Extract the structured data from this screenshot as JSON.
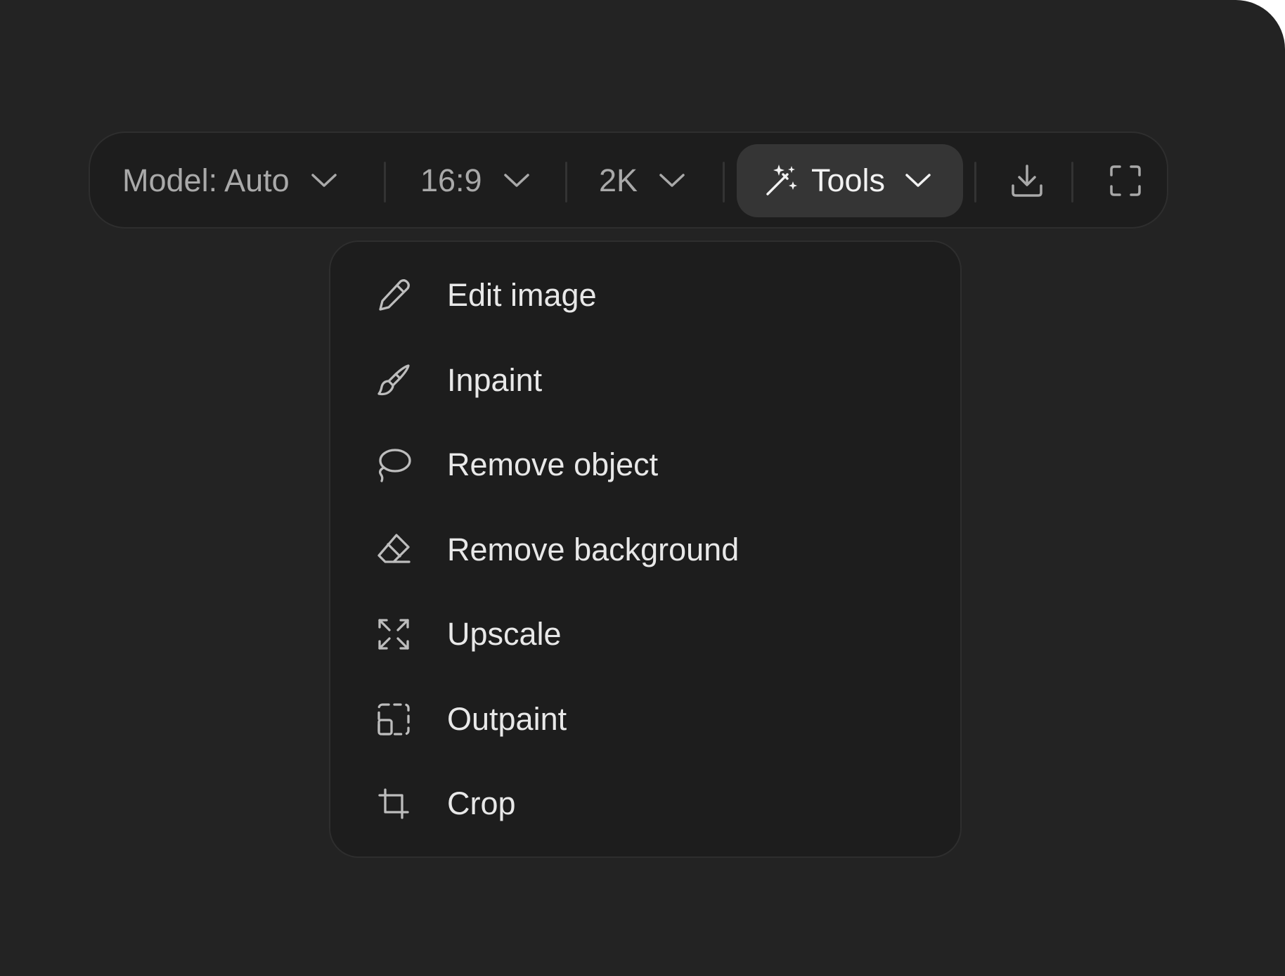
{
  "toolbar": {
    "model": {
      "label": "Model: Auto",
      "icon": "chevron-down-icon"
    },
    "aspect_ratio": {
      "label": "16:9",
      "icon": "chevron-down-icon"
    },
    "resolution": {
      "label": "2K",
      "icon": "chevron-down-icon"
    },
    "tools": {
      "label": "Tools",
      "icon": "magic-wand-icon",
      "state": "open"
    },
    "download": {
      "icon": "download-icon"
    },
    "fullscreen": {
      "icon": "fullscreen-icon"
    }
  },
  "tools_menu": {
    "items": [
      {
        "label": "Edit image",
        "icon": "pencil-icon"
      },
      {
        "label": "Inpaint",
        "icon": "brush-icon"
      },
      {
        "label": "Remove object",
        "icon": "lasso-icon"
      },
      {
        "label": "Remove background",
        "icon": "eraser-icon"
      },
      {
        "label": "Upscale",
        "icon": "expand-arrows-icon"
      },
      {
        "label": "Outpaint",
        "icon": "outpaint-frame-icon"
      },
      {
        "label": "Crop",
        "icon": "crop-icon"
      }
    ]
  },
  "colors": {
    "canvas_bg": "#232323",
    "toolbar_bg": "#1d1d1d",
    "active_button_bg": "#353535",
    "text_muted": "#a9a9a9",
    "text_primary": "#e8e8e8"
  }
}
